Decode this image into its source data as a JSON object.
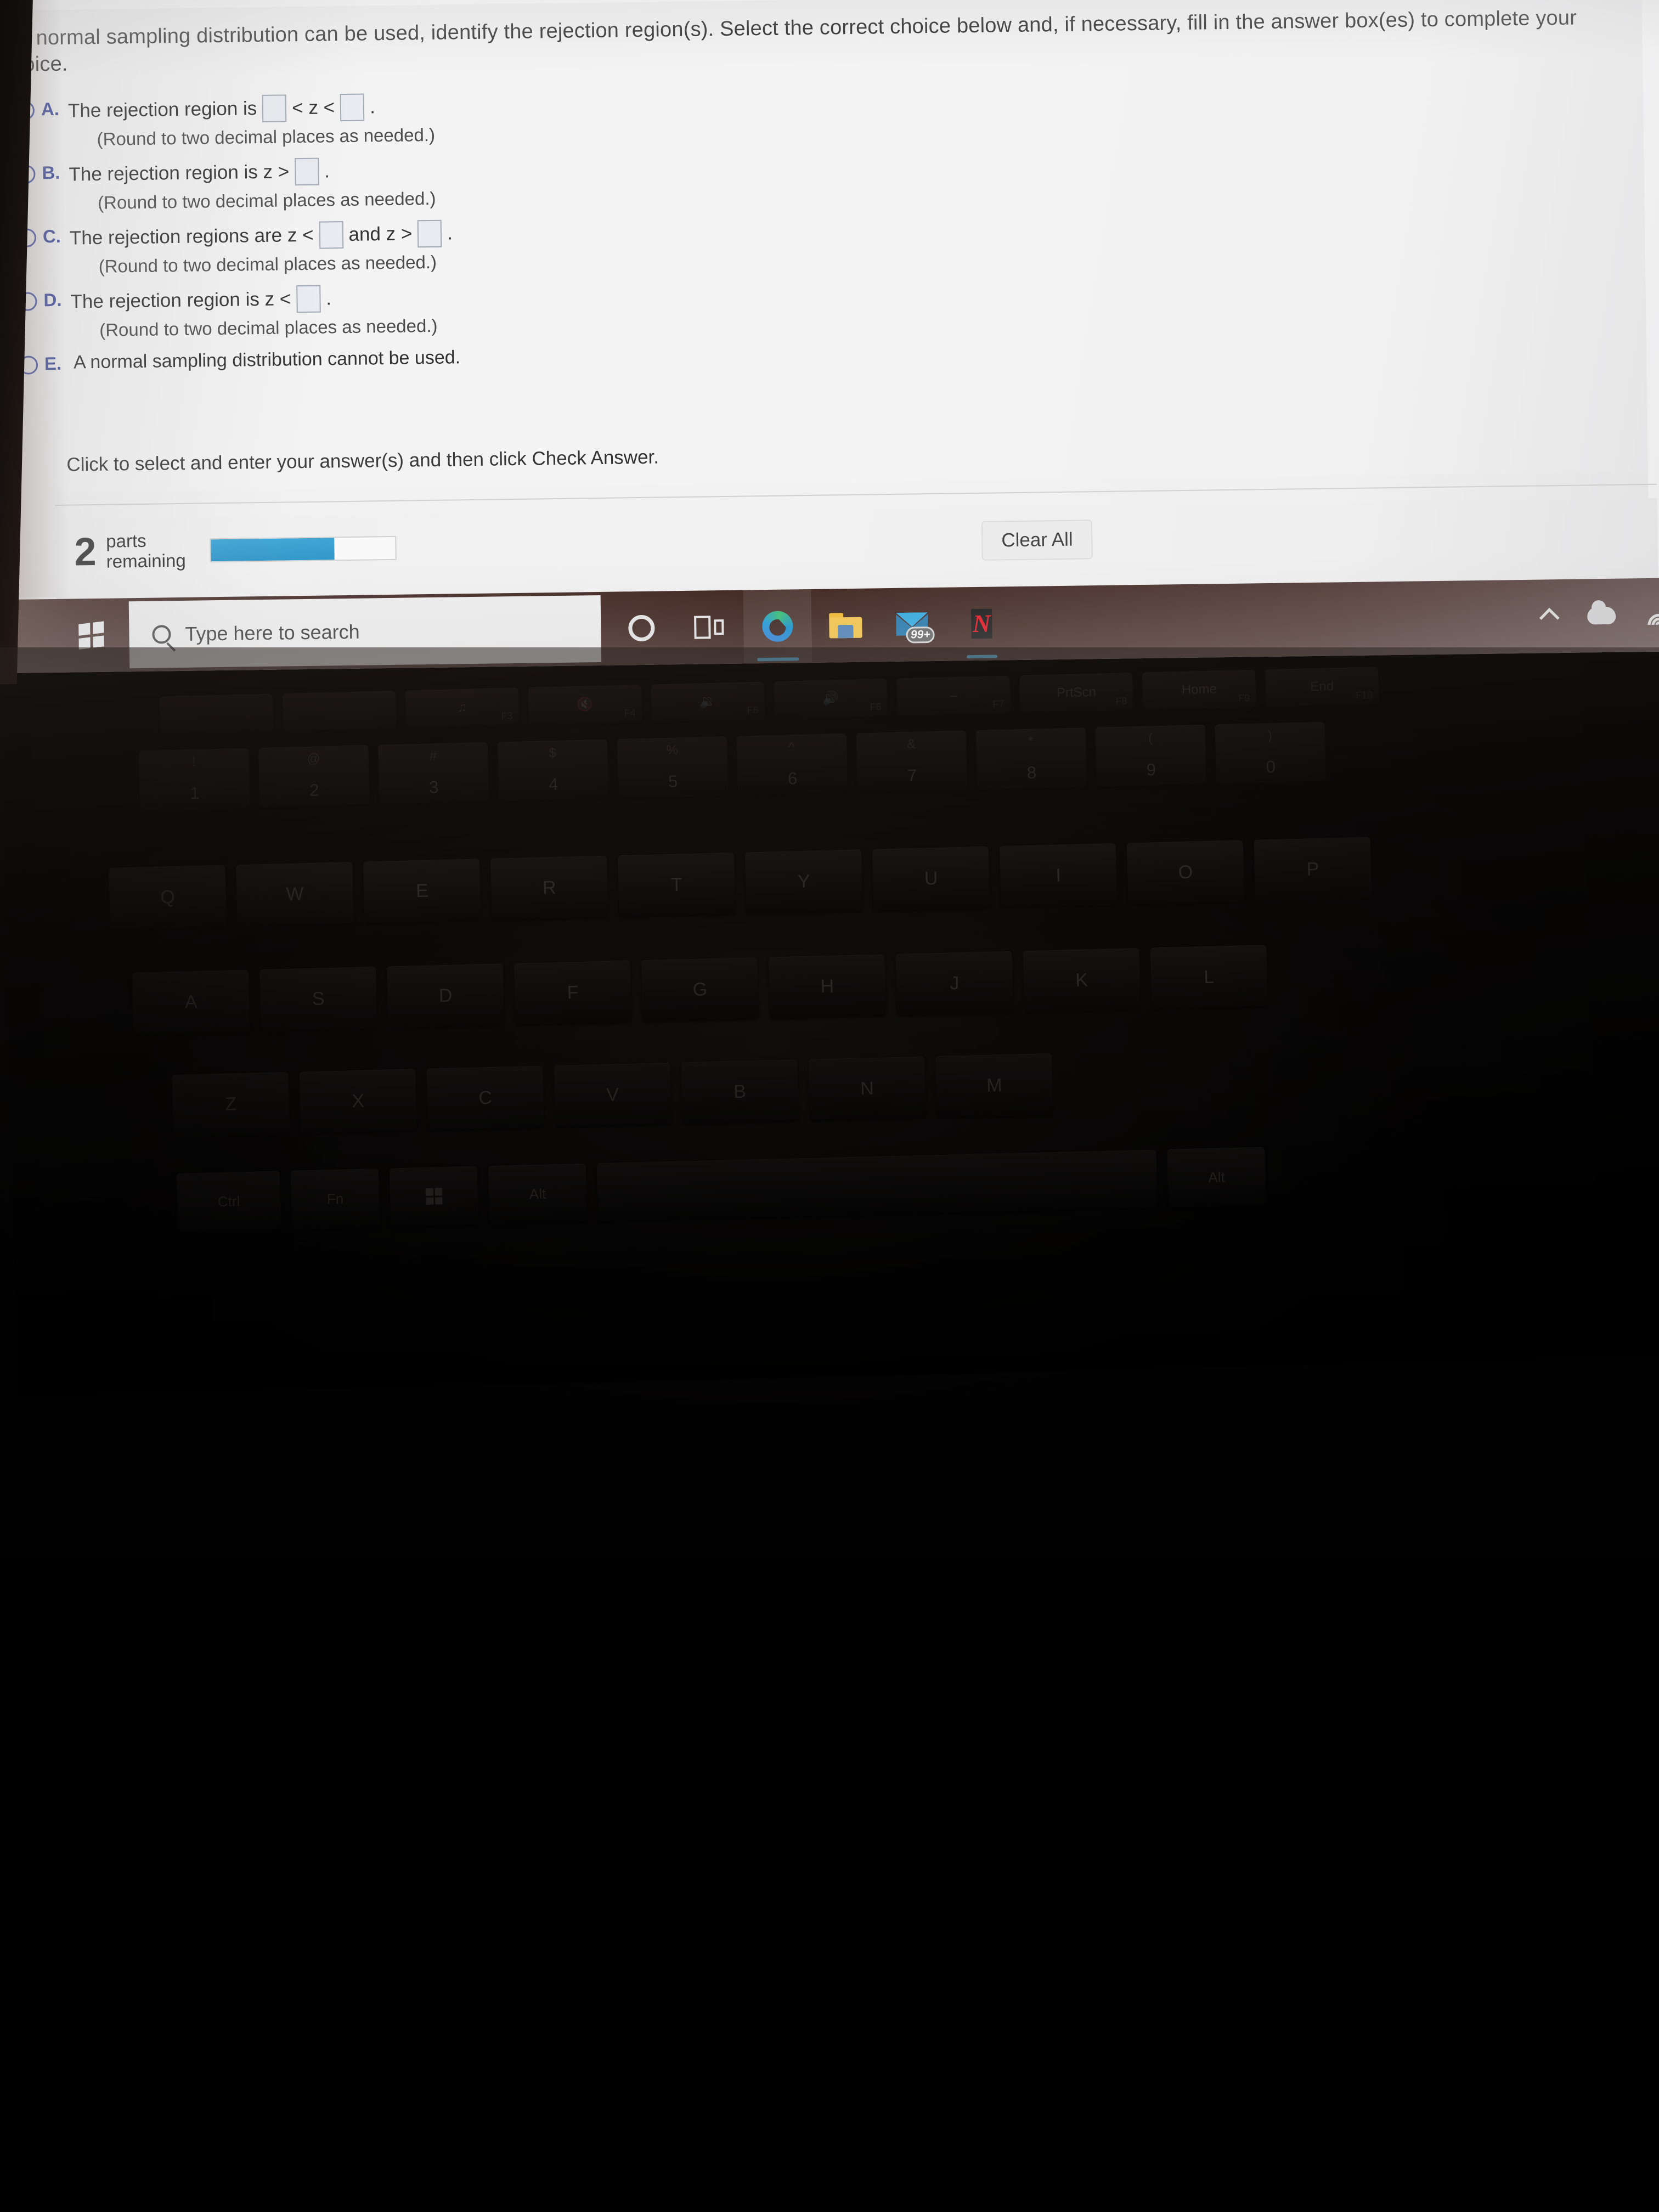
{
  "question": {
    "text": "If a normal sampling distribution can be used, identify the rejection region(s). Select the correct choice below and, if necessary, fill in the answer box(es) to complete your choice."
  },
  "choices": [
    {
      "letter": "A.",
      "prefix": "The rejection region is",
      "mid": "< z <",
      "suffix": ".",
      "boxes": 2,
      "note": "(Round to two decimal places as needed.)"
    },
    {
      "letter": "B.",
      "prefix": "The rejection region is z >",
      "mid": "",
      "suffix": ".",
      "boxes": 1,
      "note": "(Round to two decimal places as needed.)"
    },
    {
      "letter": "C.",
      "prefix": "The rejection regions are z <",
      "mid": "and z >",
      "suffix": ".",
      "boxes": 2,
      "note": "(Round to two decimal places as needed.)"
    },
    {
      "letter": "D.",
      "prefix": "The rejection region is z <",
      "mid": "",
      "suffix": ".",
      "boxes": 1,
      "note": "(Round to two decimal places as needed.)"
    },
    {
      "letter": "E.",
      "prefix": "A normal sampling distribution cannot be used.",
      "mid": "",
      "suffix": "",
      "boxes": 0,
      "note": ""
    }
  ],
  "hint": "Click to select and enter your answer(s) and then click Check Answer.",
  "footer": {
    "parts_count": "2",
    "parts_label_line1": "parts",
    "parts_label_line2": "remaining",
    "progress_percent": 67,
    "clear_all_label": "Clear All"
  },
  "taskbar": {
    "search_placeholder": "Type here to search",
    "start_icon": "windows-logo-icon",
    "items": [
      {
        "name": "cortana-icon",
        "label": ""
      },
      {
        "name": "task-view-icon",
        "label": ""
      },
      {
        "name": "microsoft-edge-icon",
        "label": ""
      },
      {
        "name": "file-explorer-icon",
        "label": ""
      },
      {
        "name": "mail-icon",
        "label": "99+"
      },
      {
        "name": "netflix-icon",
        "label": "N"
      }
    ],
    "tray": [
      {
        "name": "show-hidden-icons-chevron-icon"
      },
      {
        "name": "onedrive-cloud-icon"
      },
      {
        "name": "wifi-icon"
      }
    ]
  },
  "keyboard": {
    "fn_row": [
      {
        "label": "",
        "sub": ""
      },
      {
        "label": "",
        "sub": ""
      },
      {
        "label": "♫",
        "sub": "F3"
      },
      {
        "label": "🔇",
        "sub": "F4"
      },
      {
        "label": "🔉",
        "sub": "F5"
      },
      {
        "label": "🔊",
        "sub": "F6"
      },
      {
        "label": "–",
        "sub": "F7"
      },
      {
        "label": "PrtScn",
        "sub": "F8"
      },
      {
        "label": "Home",
        "sub": "F9"
      },
      {
        "label": "End",
        "sub": "F10"
      }
    ],
    "num_row": [
      {
        "shift": "!",
        "main": "1"
      },
      {
        "shift": "@",
        "main": "2"
      },
      {
        "shift": "#",
        "main": "3"
      },
      {
        "shift": "$",
        "main": "4"
      },
      {
        "shift": "%",
        "main": "5"
      },
      {
        "shift": "^",
        "main": "6"
      },
      {
        "shift": "&",
        "main": "7"
      },
      {
        "shift": "*",
        "main": "8"
      },
      {
        "shift": "(",
        "main": "9"
      },
      {
        "shift": ")",
        "main": "0"
      }
    ],
    "q_row": [
      "Q",
      "W",
      "E",
      "R",
      "T",
      "Y",
      "U",
      "I",
      "O",
      "P"
    ],
    "a_row": [
      "A",
      "S",
      "D",
      "F",
      "G",
      "H",
      "J",
      "K",
      "L"
    ],
    "z_row": [
      "Z",
      "X",
      "C",
      "V",
      "B",
      "N",
      "M"
    ],
    "space_row": [
      "Ctrl",
      "Fn",
      "⊞",
      "Alt",
      "",
      "Alt"
    ]
  },
  "colors": {
    "accent_blue": "#1f8fc6",
    "radio_blue": "#3c4da5",
    "taskbar_brown": "#3a1f19",
    "page_bg": "#f4f4f4"
  }
}
